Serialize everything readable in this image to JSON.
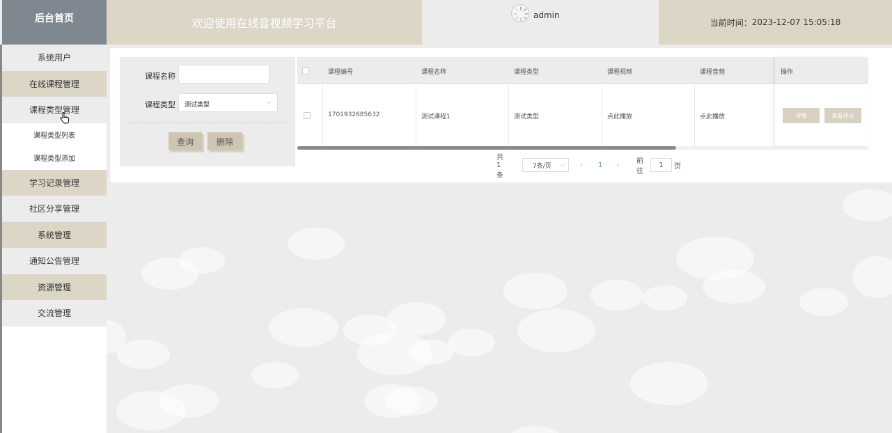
{
  "header": {
    "brand": "后台首页",
    "welcome": "欢迎使用在线音视频学习平台",
    "username": "admin",
    "time_label": "当前时间：",
    "time_value": "2023-12-07 15:05:18"
  },
  "sidebar": {
    "items": [
      {
        "label": "系统用户"
      },
      {
        "label": "在线课程管理"
      },
      {
        "label": "课程类型管理"
      },
      {
        "label": "课程类型列表"
      },
      {
        "label": "课程类型添加"
      },
      {
        "label": "学习记录管理"
      },
      {
        "label": "社区分享管理"
      },
      {
        "label": "系统管理"
      },
      {
        "label": "通知公告管理"
      },
      {
        "label": "资源管理"
      },
      {
        "label": "交流管理"
      }
    ]
  },
  "search": {
    "name_label": "课程名称",
    "name_value": "",
    "type_label": "课程类型",
    "type_value": "测试类型",
    "query_button": "查询",
    "delete_button": "删除"
  },
  "table": {
    "columns": [
      "课程编号",
      "课程名称",
      "课程类型",
      "课程视频",
      "课程音频",
      "操作"
    ],
    "rows": [
      {
        "id": "1701932685632",
        "name": "测试课程1",
        "type": "测试类型",
        "video": "点此播放",
        "audio": "点此播放",
        "detail_button": "详情",
        "comment_button": "查看评论"
      }
    ]
  },
  "pagination": {
    "total": "共 1 条",
    "page_size": "7条/页",
    "current_page": "1",
    "goto_label": "前往",
    "goto_value": "1",
    "page_suffix": "页"
  },
  "colors": {
    "accent_tan": "#dcd6c7",
    "brand_gray": "#7f8891",
    "active_page": "#409eff"
  }
}
